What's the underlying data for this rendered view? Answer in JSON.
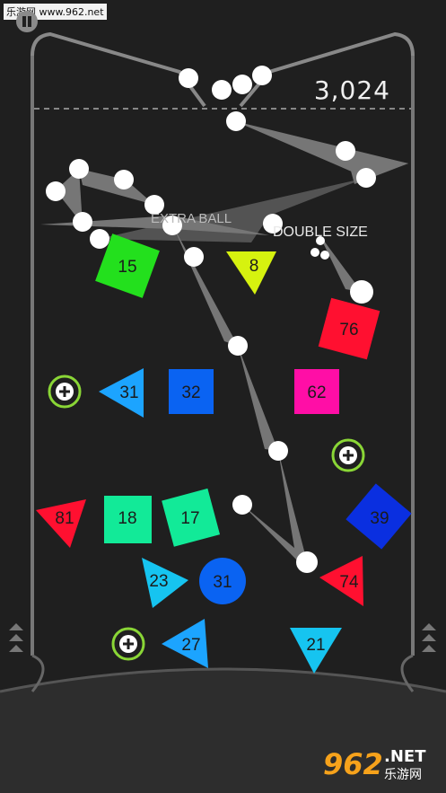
{
  "watermark": {
    "top_left": "乐游网 www.962.net",
    "logo_number": "962",
    "logo_suffix": ".NET",
    "logo_cn": "乐游网"
  },
  "score": "3,024",
  "labels": {
    "extra_ball": "EXTRA BALL",
    "double_size": "DOUBLE SIZE"
  },
  "colors": {
    "background": "#1f1f1f",
    "green": "#23e01d",
    "yellow": "#d6f20f",
    "red": "#ff1030",
    "blue_light": "#1ca4ff",
    "blue_mid": "#0a63f2",
    "blue_dark": "#0a2fe0",
    "pink": "#ff0ea6",
    "mint": "#12ea98",
    "cyan": "#16c4f0",
    "plus_ring": "#8ad636"
  },
  "blocks": [
    {
      "shape": "square",
      "value": "15",
      "color": "green"
    },
    {
      "shape": "triangle",
      "value": "8",
      "color": "yellow"
    },
    {
      "shape": "square",
      "value": "76",
      "color": "red"
    },
    {
      "shape": "triangle",
      "value": "31",
      "color": "blue_light"
    },
    {
      "shape": "square",
      "value": "32",
      "color": "blue_light"
    },
    {
      "shape": "square",
      "value": "62",
      "color": "pink"
    },
    {
      "shape": "triangle",
      "value": "81",
      "color": "red"
    },
    {
      "shape": "square",
      "value": "18",
      "color": "mint"
    },
    {
      "shape": "square",
      "value": "17",
      "color": "mint"
    },
    {
      "shape": "square",
      "value": "39",
      "color": "blue_dark"
    },
    {
      "shape": "triangle",
      "value": "23",
      "color": "cyan"
    },
    {
      "shape": "circle",
      "value": "31",
      "color": "blue_mid"
    },
    {
      "shape": "triangle",
      "value": "74",
      "color": "red"
    },
    {
      "shape": "triangle",
      "value": "27",
      "color": "blue_light"
    },
    {
      "shape": "triangle",
      "value": "21",
      "color": "cyan"
    }
  ],
  "pickups": [
    {
      "type": "extra-ball-plus"
    },
    {
      "type": "extra-ball-plus"
    },
    {
      "type": "extra-ball-plus"
    }
  ],
  "controls": {
    "pause": "pause",
    "left_up": "up-chevrons",
    "right_up": "up-chevrons"
  }
}
